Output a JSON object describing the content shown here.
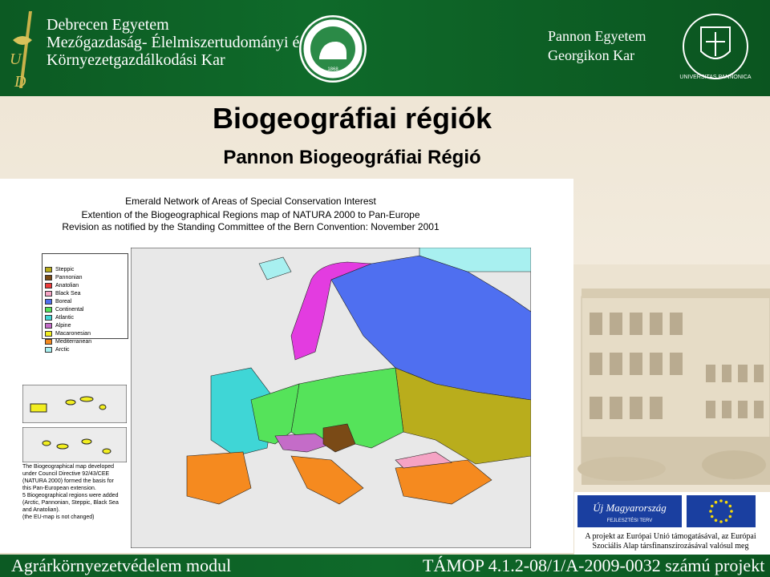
{
  "header": {
    "left_lines": [
      "Debrecen Egyetem",
      "Mezőgazdaság- Élelmiszertudományi és",
      "Környezetgazdálkodási Kar"
    ],
    "right_lines": [
      "Pannon Egyetem",
      "Georgikon Kar"
    ],
    "seal_text": "1868",
    "crest_text": "UNIVERSITAS PANNONICA"
  },
  "slide": {
    "title": "Biogeográfiai régiók",
    "subtitle": "Pannon Biogeográfiai Régió"
  },
  "map": {
    "heading_lines": [
      "Emerald Network of Areas of Special Conservation Interest",
      "Extention of the Biogeographical Regions map of NATURA 2000 to Pan-Europe",
      "Revision as notified by the Standing Committee of the Bern Convention: November 2001"
    ],
    "legend": [
      {
        "label": "Steppic",
        "color": "#b9ad1c"
      },
      {
        "label": "Pannonian",
        "color": "#7a4a16"
      },
      {
        "label": "Anatolian",
        "color": "#ee3b3b"
      },
      {
        "label": "Black Sea",
        "color": "#f5a3c4"
      },
      {
        "label": "Boreal",
        "color": "#4f6ff0"
      },
      {
        "label": "Continental",
        "color": "#55e35a"
      },
      {
        "label": "Atlantic",
        "color": "#3fd6d6"
      },
      {
        "label": "Alpine",
        "color": "#c46cc8"
      },
      {
        "label": "Macaronesian",
        "color": "#f2ee20"
      },
      {
        "label": "Mediterranean",
        "color": "#f58a1f"
      },
      {
        "label": "Arctic",
        "color": "#a8f0f0"
      }
    ],
    "note_lines": [
      "The Biogeographical map developed",
      "under Council Directive 92/43/CEE",
      "(NATURA 2000) formed the basis for",
      "this Pan-European extension.",
      "5 Biogeographical regions were added",
      "(Arctic, Pannonian, Steppic, Black Sea",
      "and Anatolian).",
      "(the EU-map is not changed)"
    ]
  },
  "eu": {
    "logo_text": "Új Magyarország",
    "logo_sub": "FEJLESZTÉSI TERV",
    "caption_lines": [
      "A projekt az Európai Unió támogatásával, az Európai",
      "Szociális Alap társfinanszírozásával valósul meg"
    ]
  },
  "footer": {
    "left": "Agrárkörnyezetvédelem modul",
    "right": "TÁMOP 4.1.2-08/1/A-2009-0032 számú projekt"
  },
  "colors": {
    "header_green": "#0f6a2a",
    "eu_blue": "#1a3fa0",
    "eu_gold": "#f5d90a"
  }
}
